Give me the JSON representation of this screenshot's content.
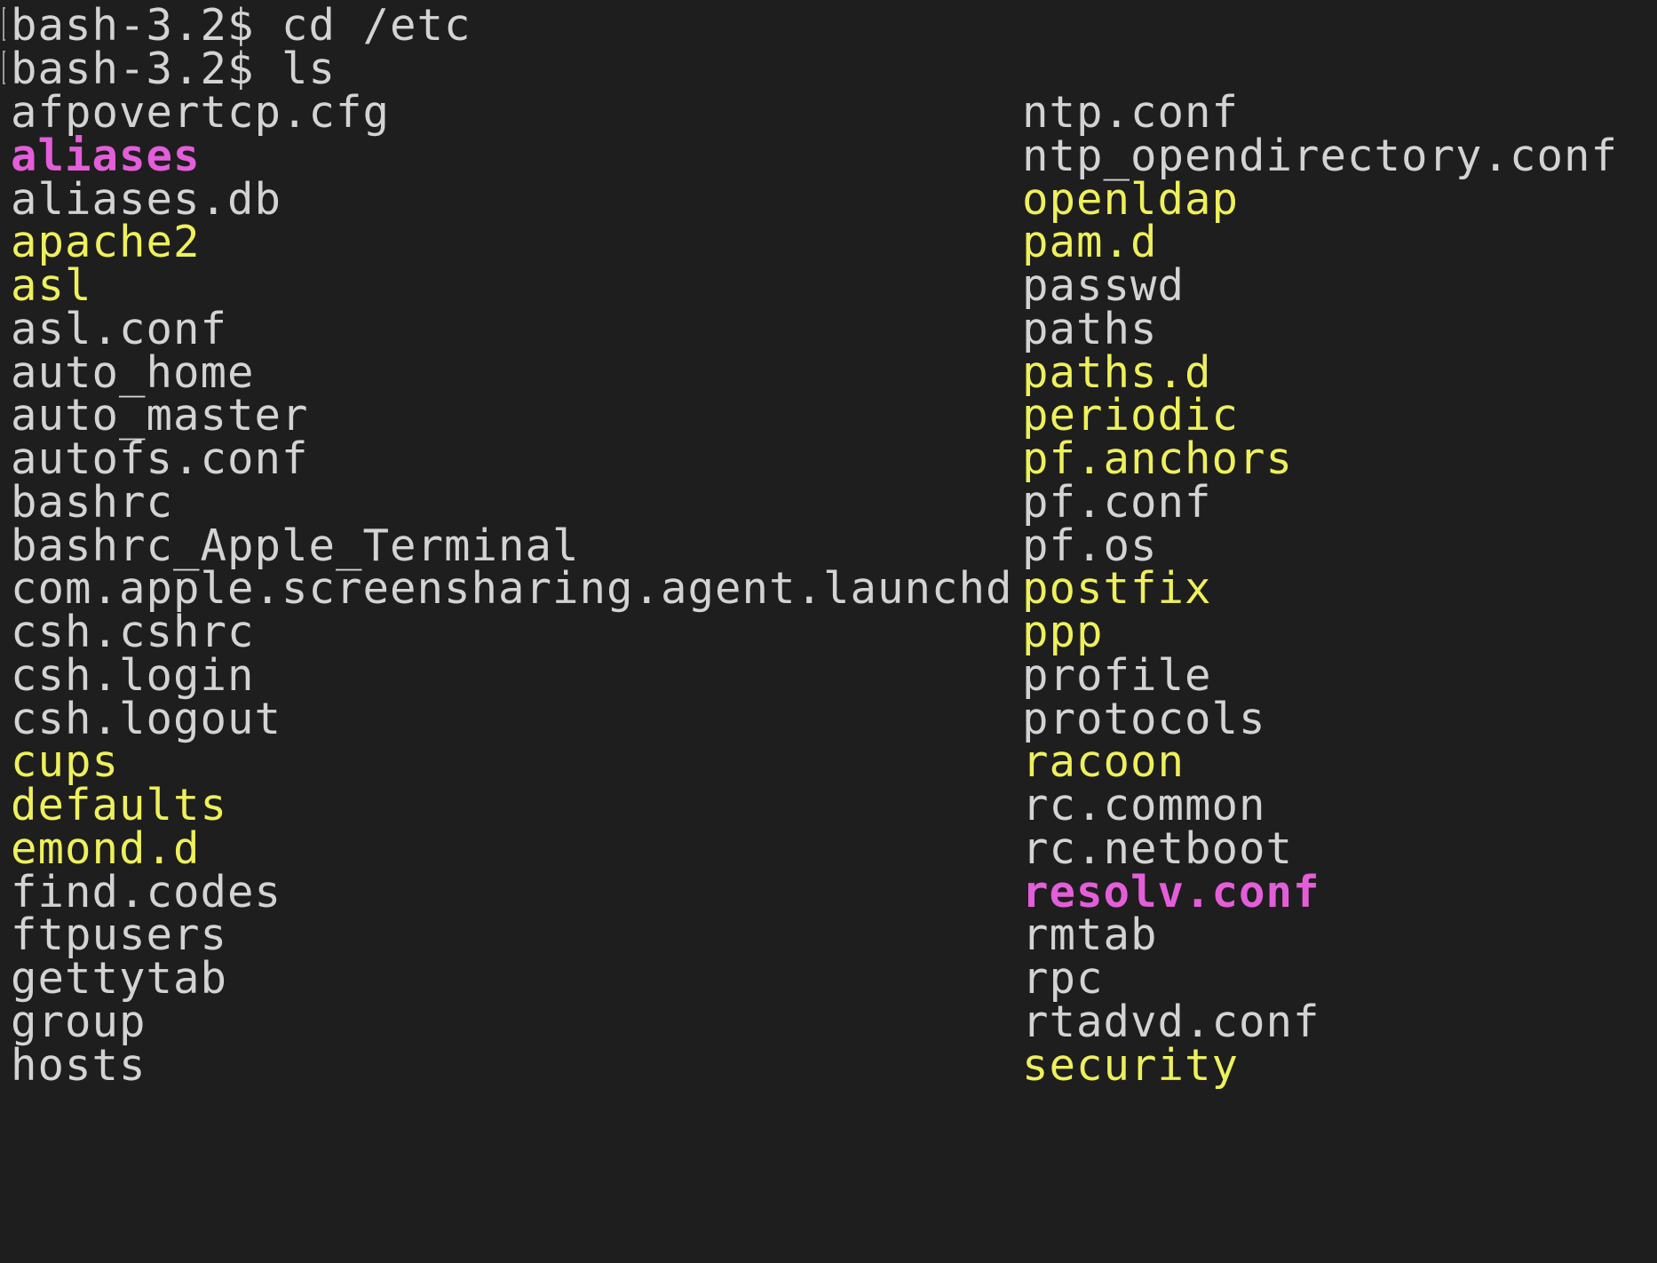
{
  "prompt": {
    "lines": [
      {
        "text": "bash-3.2$ cd /etc"
      },
      {
        "text": "bash-3.2$ ls"
      }
    ]
  },
  "listing": {
    "left_column": [
      {
        "name": "afpovertcp.cfg",
        "kind": "file"
      },
      {
        "name": "aliases",
        "kind": "link"
      },
      {
        "name": "aliases.db",
        "kind": "file"
      },
      {
        "name": "apache2",
        "kind": "dir"
      },
      {
        "name": "asl",
        "kind": "dir"
      },
      {
        "name": "asl.conf",
        "kind": "file"
      },
      {
        "name": "auto_home",
        "kind": "file"
      },
      {
        "name": "auto_master",
        "kind": "file"
      },
      {
        "name": "autofs.conf",
        "kind": "file"
      },
      {
        "name": "bashrc",
        "kind": "file"
      },
      {
        "name": "bashrc_Apple_Terminal",
        "kind": "file"
      },
      {
        "name": "com.apple.screensharing.agent.launchd",
        "kind": "file"
      },
      {
        "name": "csh.cshrc",
        "kind": "file"
      },
      {
        "name": "csh.login",
        "kind": "file"
      },
      {
        "name": "csh.logout",
        "kind": "file"
      },
      {
        "name": "cups",
        "kind": "dir"
      },
      {
        "name": "defaults",
        "kind": "dir"
      },
      {
        "name": "emond.d",
        "kind": "dir"
      },
      {
        "name": "find.codes",
        "kind": "file"
      },
      {
        "name": "ftpusers",
        "kind": "file"
      },
      {
        "name": "gettytab",
        "kind": "file"
      },
      {
        "name": "group",
        "kind": "file"
      },
      {
        "name": "hosts",
        "kind": "file"
      }
    ],
    "right_column": [
      {
        "name": "ntp.conf",
        "kind": "file"
      },
      {
        "name": "ntp_opendirectory.conf",
        "kind": "file"
      },
      {
        "name": "openldap",
        "kind": "dir"
      },
      {
        "name": "pam.d",
        "kind": "dir"
      },
      {
        "name": "passwd",
        "kind": "file"
      },
      {
        "name": "paths",
        "kind": "file"
      },
      {
        "name": "paths.d",
        "kind": "dir"
      },
      {
        "name": "periodic",
        "kind": "dir"
      },
      {
        "name": "pf.anchors",
        "kind": "dir"
      },
      {
        "name": "pf.conf",
        "kind": "file"
      },
      {
        "name": "pf.os",
        "kind": "file"
      },
      {
        "name": "postfix",
        "kind": "dir"
      },
      {
        "name": "ppp",
        "kind": "dir"
      },
      {
        "name": "profile",
        "kind": "file"
      },
      {
        "name": "protocols",
        "kind": "file"
      },
      {
        "name": "racoon",
        "kind": "dir"
      },
      {
        "name": "rc.common",
        "kind": "file"
      },
      {
        "name": "rc.netboot",
        "kind": "file"
      },
      {
        "name": "resolv.conf",
        "kind": "link"
      },
      {
        "name": "rmtab",
        "kind": "file"
      },
      {
        "name": "rpc",
        "kind": "file"
      },
      {
        "name": "rtadvd.conf",
        "kind": "file"
      },
      {
        "name": "security",
        "kind": "dir"
      }
    ]
  },
  "colors": {
    "background": "#1e1e1e",
    "text": "#d3d3d3",
    "directory": "#eef05c",
    "symlink": "#e35ed8"
  }
}
